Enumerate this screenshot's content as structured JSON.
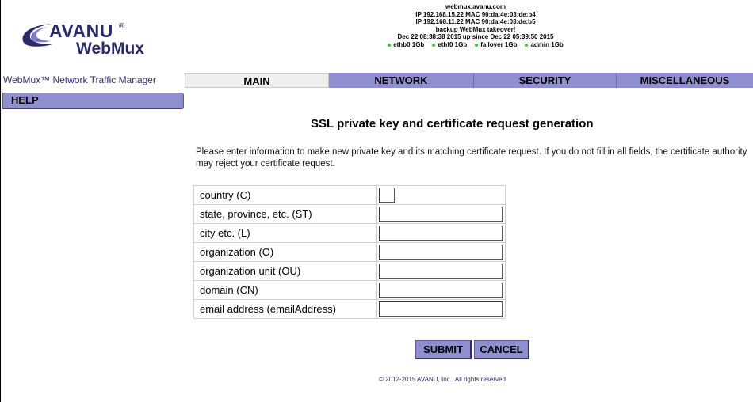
{
  "header": {
    "logo_brand": "AVANU",
    "logo_registered": "®",
    "logo_product": "WebMux",
    "hostname": "webmux.avanu.com",
    "ip_lines": [
      "IP 192.168.15.22   MAC 90:da:4e:03:de:b4",
      "IP 192.168.11.22   MAC 90:da:4e:03:de:b5"
    ],
    "takeover_status": "backup WebMux takeover!",
    "uptime": "Dec 22 08:38:38 2015 up since Dec 22 05:39:50 2015",
    "interfaces": [
      {
        "label": "ethb0 1Gb",
        "status_color": "#3cc43c"
      },
      {
        "label": "ethf0 1Gb",
        "status_color": "#3cc43c"
      },
      {
        "label": "failover 1Gb",
        "status_color": "#3cc43c"
      },
      {
        "label": "admin 1Gb",
        "status_color": "#3cc43c"
      }
    ]
  },
  "nav": {
    "app_title": "WebMux™ Network Traffic Manager",
    "tabs": [
      {
        "label": "MAIN"
      },
      {
        "label": "NETWORK"
      },
      {
        "label": "SECURITY"
      },
      {
        "label": "MISCELLANEOUS"
      }
    ],
    "help_label": "HELP"
  },
  "main": {
    "heading": "SSL private key and certificate request generation",
    "intro": "Please enter information to make new private key and its matching certificate request. If you do not fill in all fields, the certificate authority may reject your certificate request.",
    "fields": [
      {
        "label": "country (C)",
        "value": ""
      },
      {
        "label": "state, province, etc. (ST)",
        "value": ""
      },
      {
        "label": "city etc. (L)",
        "value": ""
      },
      {
        "label": "organization (O)",
        "value": ""
      },
      {
        "label": "organization unit (OU)",
        "value": ""
      },
      {
        "label": "domain (CN)",
        "value": ""
      },
      {
        "label": "email address (emailAddress)",
        "value": ""
      }
    ],
    "submit_label": "SUBMIT",
    "cancel_label": "CANCEL"
  },
  "footer": {
    "copyright": "© 2012-2015 AVANU, Inc.. All rights reserved."
  },
  "colors": {
    "tab_active_bg": "#eeeeee",
    "tab_bg": "#8f8fcf",
    "brand": "#2a2a6b",
    "status_ok": "#3cc43c"
  }
}
